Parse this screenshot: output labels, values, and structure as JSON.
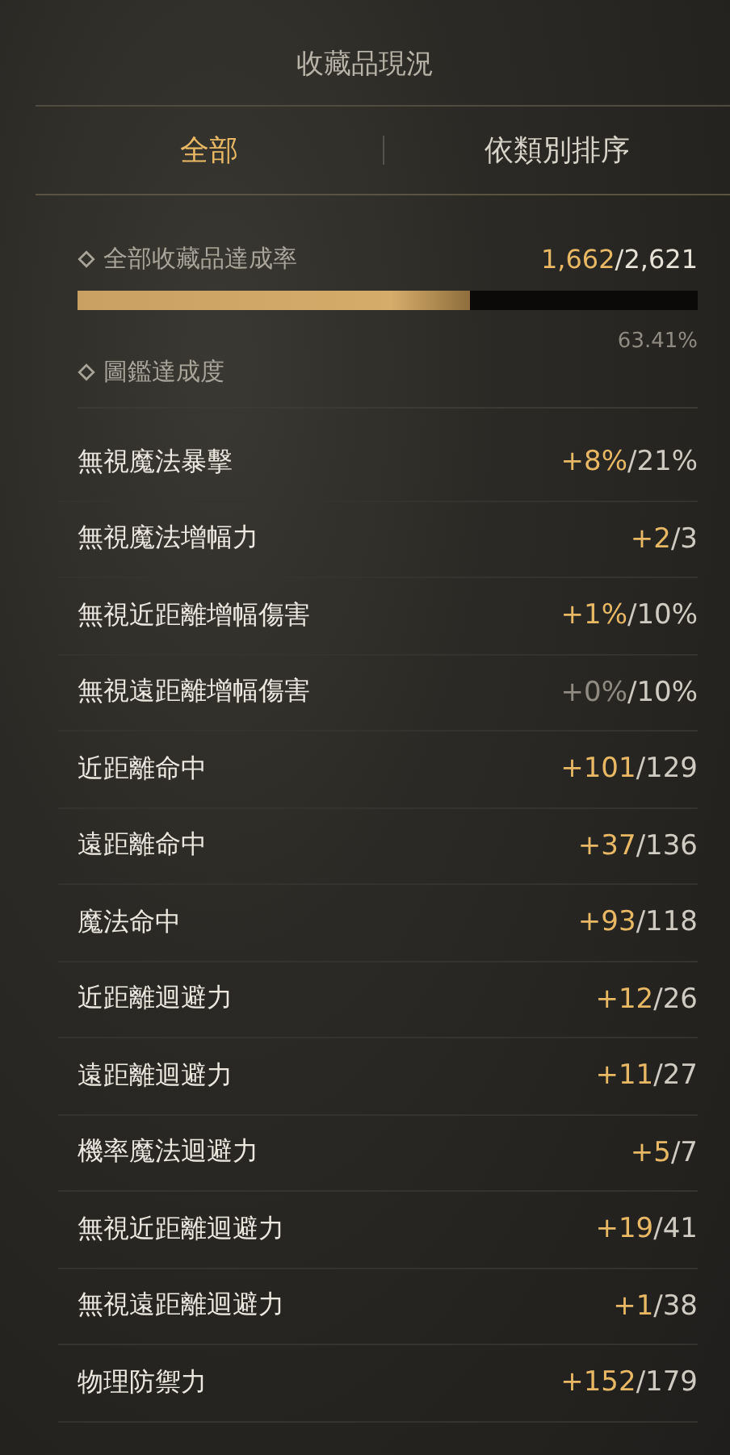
{
  "title": "收藏品現況",
  "tabs": [
    {
      "label": "全部",
      "selected": true
    },
    {
      "label": "依類別排序",
      "selected": false
    }
  ],
  "overall": {
    "label": "全部收藏品達成率",
    "current": "1,662",
    "total": "/2,621",
    "level": 0.6341,
    "percent": "63.41%"
  },
  "codex": {
    "label": "圖鑑達成度"
  },
  "stats": [
    {
      "name": "無視魔法暴擊",
      "bonus": "+8%",
      "max": "/21%",
      "active": true
    },
    {
      "name": "無視魔法增幅力",
      "bonus": "+2",
      "max": "/3",
      "active": true
    },
    {
      "name": "無視近距離增幅傷害",
      "bonus": "+1%",
      "max": "/10%",
      "active": true
    },
    {
      "name": "無視遠距離增幅傷害",
      "bonus": "+0%",
      "max": "/10%",
      "active": false
    },
    {
      "name": "近距離命中",
      "bonus": "+101",
      "max": "/129",
      "active": true
    },
    {
      "name": "遠距離命中",
      "bonus": "+37",
      "max": "/136",
      "active": true
    },
    {
      "name": "魔法命中",
      "bonus": "+93",
      "max": "/118",
      "active": true
    },
    {
      "name": "近距離迴避力",
      "bonus": "+12",
      "max": "/26",
      "active": true
    },
    {
      "name": "遠距離迴避力",
      "bonus": "+11",
      "max": "/27",
      "active": true
    },
    {
      "name": "機率魔法迴避力",
      "bonus": "+5",
      "max": "/7",
      "active": true
    },
    {
      "name": "無視近距離迴避力",
      "bonus": "+19",
      "max": "/41",
      "active": true
    },
    {
      "name": "無視遠距離迴避力",
      "bonus": "+1",
      "max": "/38",
      "active": true
    },
    {
      "name": "物理防禦力",
      "bonus": "+152",
      "max": "/179",
      "active": true
    }
  ]
}
